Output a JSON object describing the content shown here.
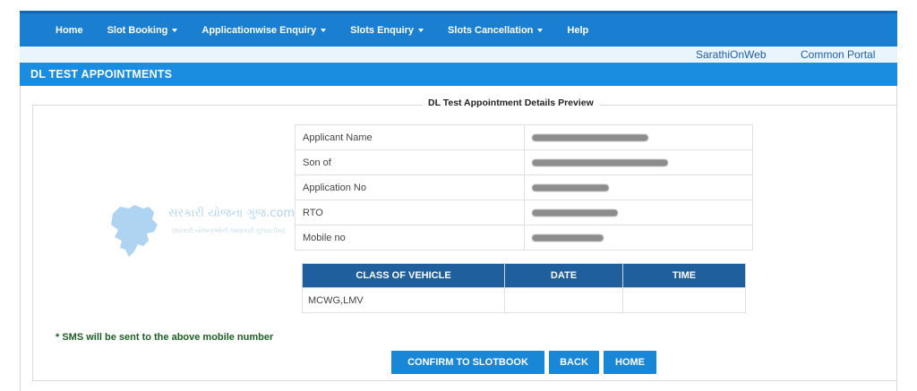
{
  "nav": {
    "items": [
      {
        "label": "Home",
        "dropdown": false
      },
      {
        "label": "Slot Booking",
        "dropdown": true
      },
      {
        "label": "Applicationwise Enquiry",
        "dropdown": true
      },
      {
        "label": "Slots Enquiry",
        "dropdown": true
      },
      {
        "label": "Slots Cancellation",
        "dropdown": true
      },
      {
        "label": "Help",
        "dropdown": false
      }
    ]
  },
  "sublinks": {
    "sarathi": "SarathiOnWeb",
    "common_portal": "Common Portal"
  },
  "section": {
    "title": "DL TEST APPOINTMENTS"
  },
  "preview": {
    "legend": "DL Test Appointment Details Preview",
    "rows": [
      {
        "label": "Applicant Name"
      },
      {
        "label": "Son of"
      },
      {
        "label": "Application No"
      },
      {
        "label": "RTO"
      },
      {
        "label": "Mobile no"
      }
    ]
  },
  "vehicle_table": {
    "headers": [
      "CLASS OF VEHICLE",
      "DATE",
      "TIME"
    ],
    "rows": [
      [
        "MCWG,LMV",
        "",
        ""
      ]
    ]
  },
  "watermark": {
    "text": "સરકારી યોજના ગુજ.com",
    "sub": "(સરકારી યોજનાઓની જાણકારી ગુજરાતીમાં)"
  },
  "note": "* SMS will be sent to the above mobile number",
  "buttons": {
    "confirm": "CONFIRM TO SLOTBOOK",
    "back": "BACK",
    "home": "HOME"
  },
  "colors": {
    "navbar": "#1a7fd1",
    "section_header": "#1a8de1",
    "table_header": "#1f5f9d",
    "button": "#1a86d6",
    "note": "#1c5f25"
  }
}
